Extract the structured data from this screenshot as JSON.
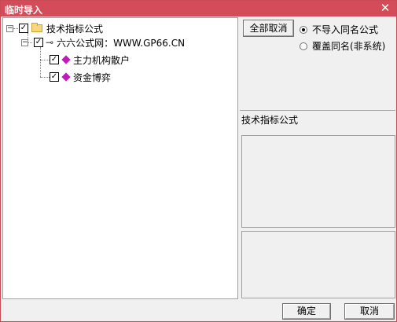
{
  "window": {
    "title": "临时导入",
    "close_glyph": "✕"
  },
  "tree": {
    "root": {
      "label": "技术指标公式",
      "checked": true,
      "expander": "−"
    },
    "child": {
      "label": "六六公式网：WWW.GP66.CN",
      "checked": true,
      "expander": "−"
    },
    "leaves": [
      {
        "label": "主力机构散户",
        "checked": true
      },
      {
        "label": "资金博弈",
        "checked": true
      }
    ]
  },
  "options": {
    "deselect_all_button": "全部取消",
    "radio_options": [
      {
        "label": "不导入同名公式",
        "selected": true
      },
      {
        "label": "覆盖同名(非系统)",
        "selected": false
      }
    ]
  },
  "info": {
    "section_label": "技术指标公式"
  },
  "footer": {
    "ok_label": "确定",
    "cancel_label": "取消"
  },
  "colors": {
    "title_bar": "#d44c5a",
    "accent_gem": "#c21ab8"
  },
  "icons": [
    "close-icon",
    "folder-icon",
    "key-icon",
    "gem-icon",
    "checkbox-check-icon",
    "tree-expander-icon"
  ]
}
